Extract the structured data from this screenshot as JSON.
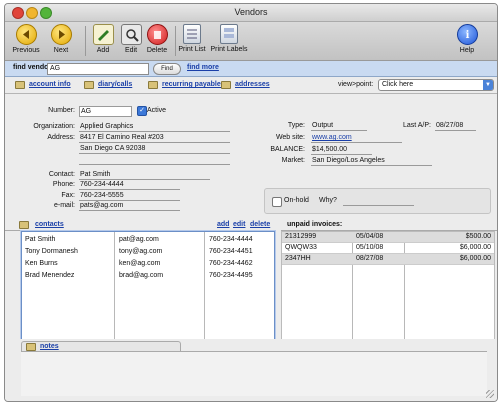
{
  "window": {
    "title": "Vendors"
  },
  "toolbar": {
    "previous": "Previous",
    "next": "Next",
    "add": "Add",
    "edit": "Edit",
    "delete": "Delete",
    "print_list": "Print List",
    "print_labels": "Print Labels",
    "help": "Help"
  },
  "find": {
    "label": "find vendor:",
    "value": "AG",
    "button": "Find",
    "more": "find more"
  },
  "nav": {
    "tabs": [
      "account info",
      "diary/calls",
      "recurring payables",
      "addresses"
    ],
    "viewpoint_label": "view>point:",
    "viewpoint_value": "Click here"
  },
  "vendor": {
    "number_label": "Number:",
    "number": "AG",
    "active_label": "Active",
    "organization_label": "Organization:",
    "organization": "Applied Graphics",
    "address_label": "Address:",
    "address1": "8417 El Camino Real #203",
    "address2": "San Diego CA  92038",
    "contact_label": "Contact:",
    "contact": "Pat Smith",
    "phone_label": "Phone:",
    "phone": "760-234-4444",
    "fax_label": "Fax:",
    "fax": "760-234-5555",
    "email_label": "e-mail:",
    "email": "pats@ag.com",
    "type_label": "Type:",
    "type": "Output",
    "last_ap_label": "Last A/P:",
    "last_ap": "08/27/08",
    "website_label": "Web site:",
    "website": "www.ag.com",
    "balance_label": "BALANCE:",
    "balance": "$14,500.00",
    "market_label": "Market:",
    "market": "San Diego/Los Angeles",
    "onhold_label": "On-hold",
    "why_label": "Why?"
  },
  "contacts": {
    "title": "contacts",
    "add": "add",
    "edit": "edit",
    "delete": "delete",
    "rows": [
      [
        "Pat Smith",
        "pat@ag.com",
        "760-234-4444"
      ],
      [
        "Tony Dormanesh",
        "tony@ag.com",
        "760-234-4451"
      ],
      [
        "Ken Burns",
        "ken@ag.com",
        "760-234-4462"
      ],
      [
        "Brad Menendez",
        "brad@ag.com",
        "760-234-4495"
      ]
    ]
  },
  "invoices": {
    "title": "unpaid invoices:",
    "rows": [
      [
        "21312999",
        "05/04/08",
        "$500.00"
      ],
      [
        "QWQW33",
        "05/10/08",
        "$6,000.00"
      ],
      [
        "2347HH",
        "08/27/08",
        "$6,000.00"
      ]
    ]
  },
  "notes": {
    "title": "notes"
  }
}
